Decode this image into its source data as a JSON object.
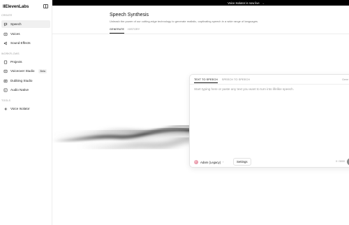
{
  "app": {
    "logo": "IIElevenLabs"
  },
  "banner": {
    "text": "Voice Isolator is now live",
    "arrow": "→"
  },
  "sidebar": {
    "sections": [
      {
        "label": "CREATE",
        "items": [
          {
            "label": "Speech",
            "icon": "speech-icon",
            "active": true
          },
          {
            "label": "Voices",
            "icon": "voices-icon",
            "active": false
          },
          {
            "label": "Sound Effects",
            "icon": "sound-effects-icon",
            "active": false
          }
        ]
      },
      {
        "label": "WORKFLOWS",
        "items": [
          {
            "label": "Projects",
            "icon": "projects-icon",
            "active": false
          },
          {
            "label": "Voiceover Studio",
            "icon": "voiceover-studio-icon",
            "active": false,
            "badge": "Beta"
          },
          {
            "label": "Dubbing Studio",
            "icon": "dubbing-studio-icon",
            "active": false
          },
          {
            "label": "Audio Native",
            "icon": "audio-native-icon",
            "active": false
          }
        ]
      },
      {
        "label": "TOOLS",
        "items": [
          {
            "label": "Voice Isolator",
            "icon": "voice-isolator-icon",
            "active": false
          }
        ]
      }
    ]
  },
  "main": {
    "title": "Speech Synthesis",
    "description": "Unleash the power of our cutting-edge technology to generate realistic, captivating speech in a wide range of languages.",
    "tabs": [
      {
        "label": "GENERATE",
        "active": true
      },
      {
        "label": "HISTORY",
        "active": false
      }
    ]
  },
  "editor": {
    "tabs": [
      {
        "label": "TEXT TO SPEECH",
        "active": true
      },
      {
        "label": "SPEECH TO SPEECH",
        "active": false
      }
    ],
    "right_label": "Gene",
    "placeholder": "Start typing here or paste any text you want to turn into lifelike speech.",
    "voice": {
      "name": "Adam (Legacy)",
      "chevron": "›"
    },
    "settings_label": "Settings",
    "char_count": "0 / 5000"
  },
  "colors": {
    "banner_bg": "#000000",
    "active_nav_bg": "#f0f0f0",
    "avatar": "#e07f97"
  }
}
